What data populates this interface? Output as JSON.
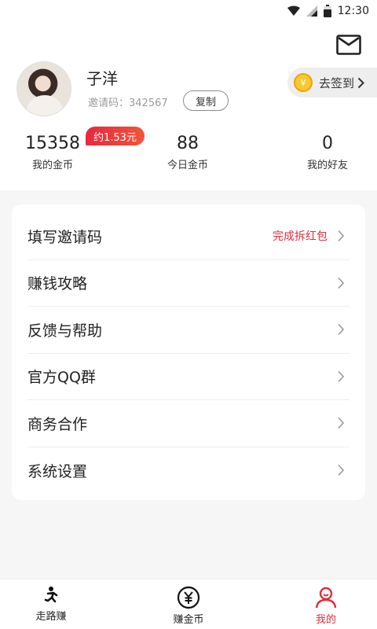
{
  "status_bar": {
    "time": "12:30",
    "icons": [
      "wifi-icon",
      "signal-icon",
      "battery-icon"
    ]
  },
  "profile": {
    "username": "子洋",
    "invite_label": "邀请码：342567",
    "copy_label": "复制",
    "checkin_label": "去签到",
    "coin_symbol": "¥"
  },
  "stats": {
    "coins": {
      "value": "15358",
      "label": "我的金币"
    },
    "coins_badge": "约1.53元",
    "today": {
      "value": "88",
      "label": "今日金币"
    },
    "friends": {
      "value": "0",
      "label": "我的好友"
    }
  },
  "menu": [
    {
      "title": "填写邀请码",
      "hint": "完成拆红包"
    },
    {
      "title": "赚钱攻略",
      "hint": ""
    },
    {
      "title": "反馈与帮助",
      "hint": ""
    },
    {
      "title": "官方QQ群",
      "hint": ""
    },
    {
      "title": "商务合作",
      "hint": ""
    },
    {
      "title": "系统设置",
      "hint": ""
    }
  ],
  "tabs": [
    {
      "label": "走路赚",
      "icon": "runner-icon",
      "active": false
    },
    {
      "label": "赚金币",
      "icon": "yuan-coin-icon",
      "active": false
    },
    {
      "label": "我的",
      "icon": "user-icon",
      "active": true
    }
  ],
  "colors": {
    "accent": "#e02d3c",
    "badge_start": "#e8283e",
    "badge_end": "#f1553a",
    "coin": "#f7c932"
  }
}
